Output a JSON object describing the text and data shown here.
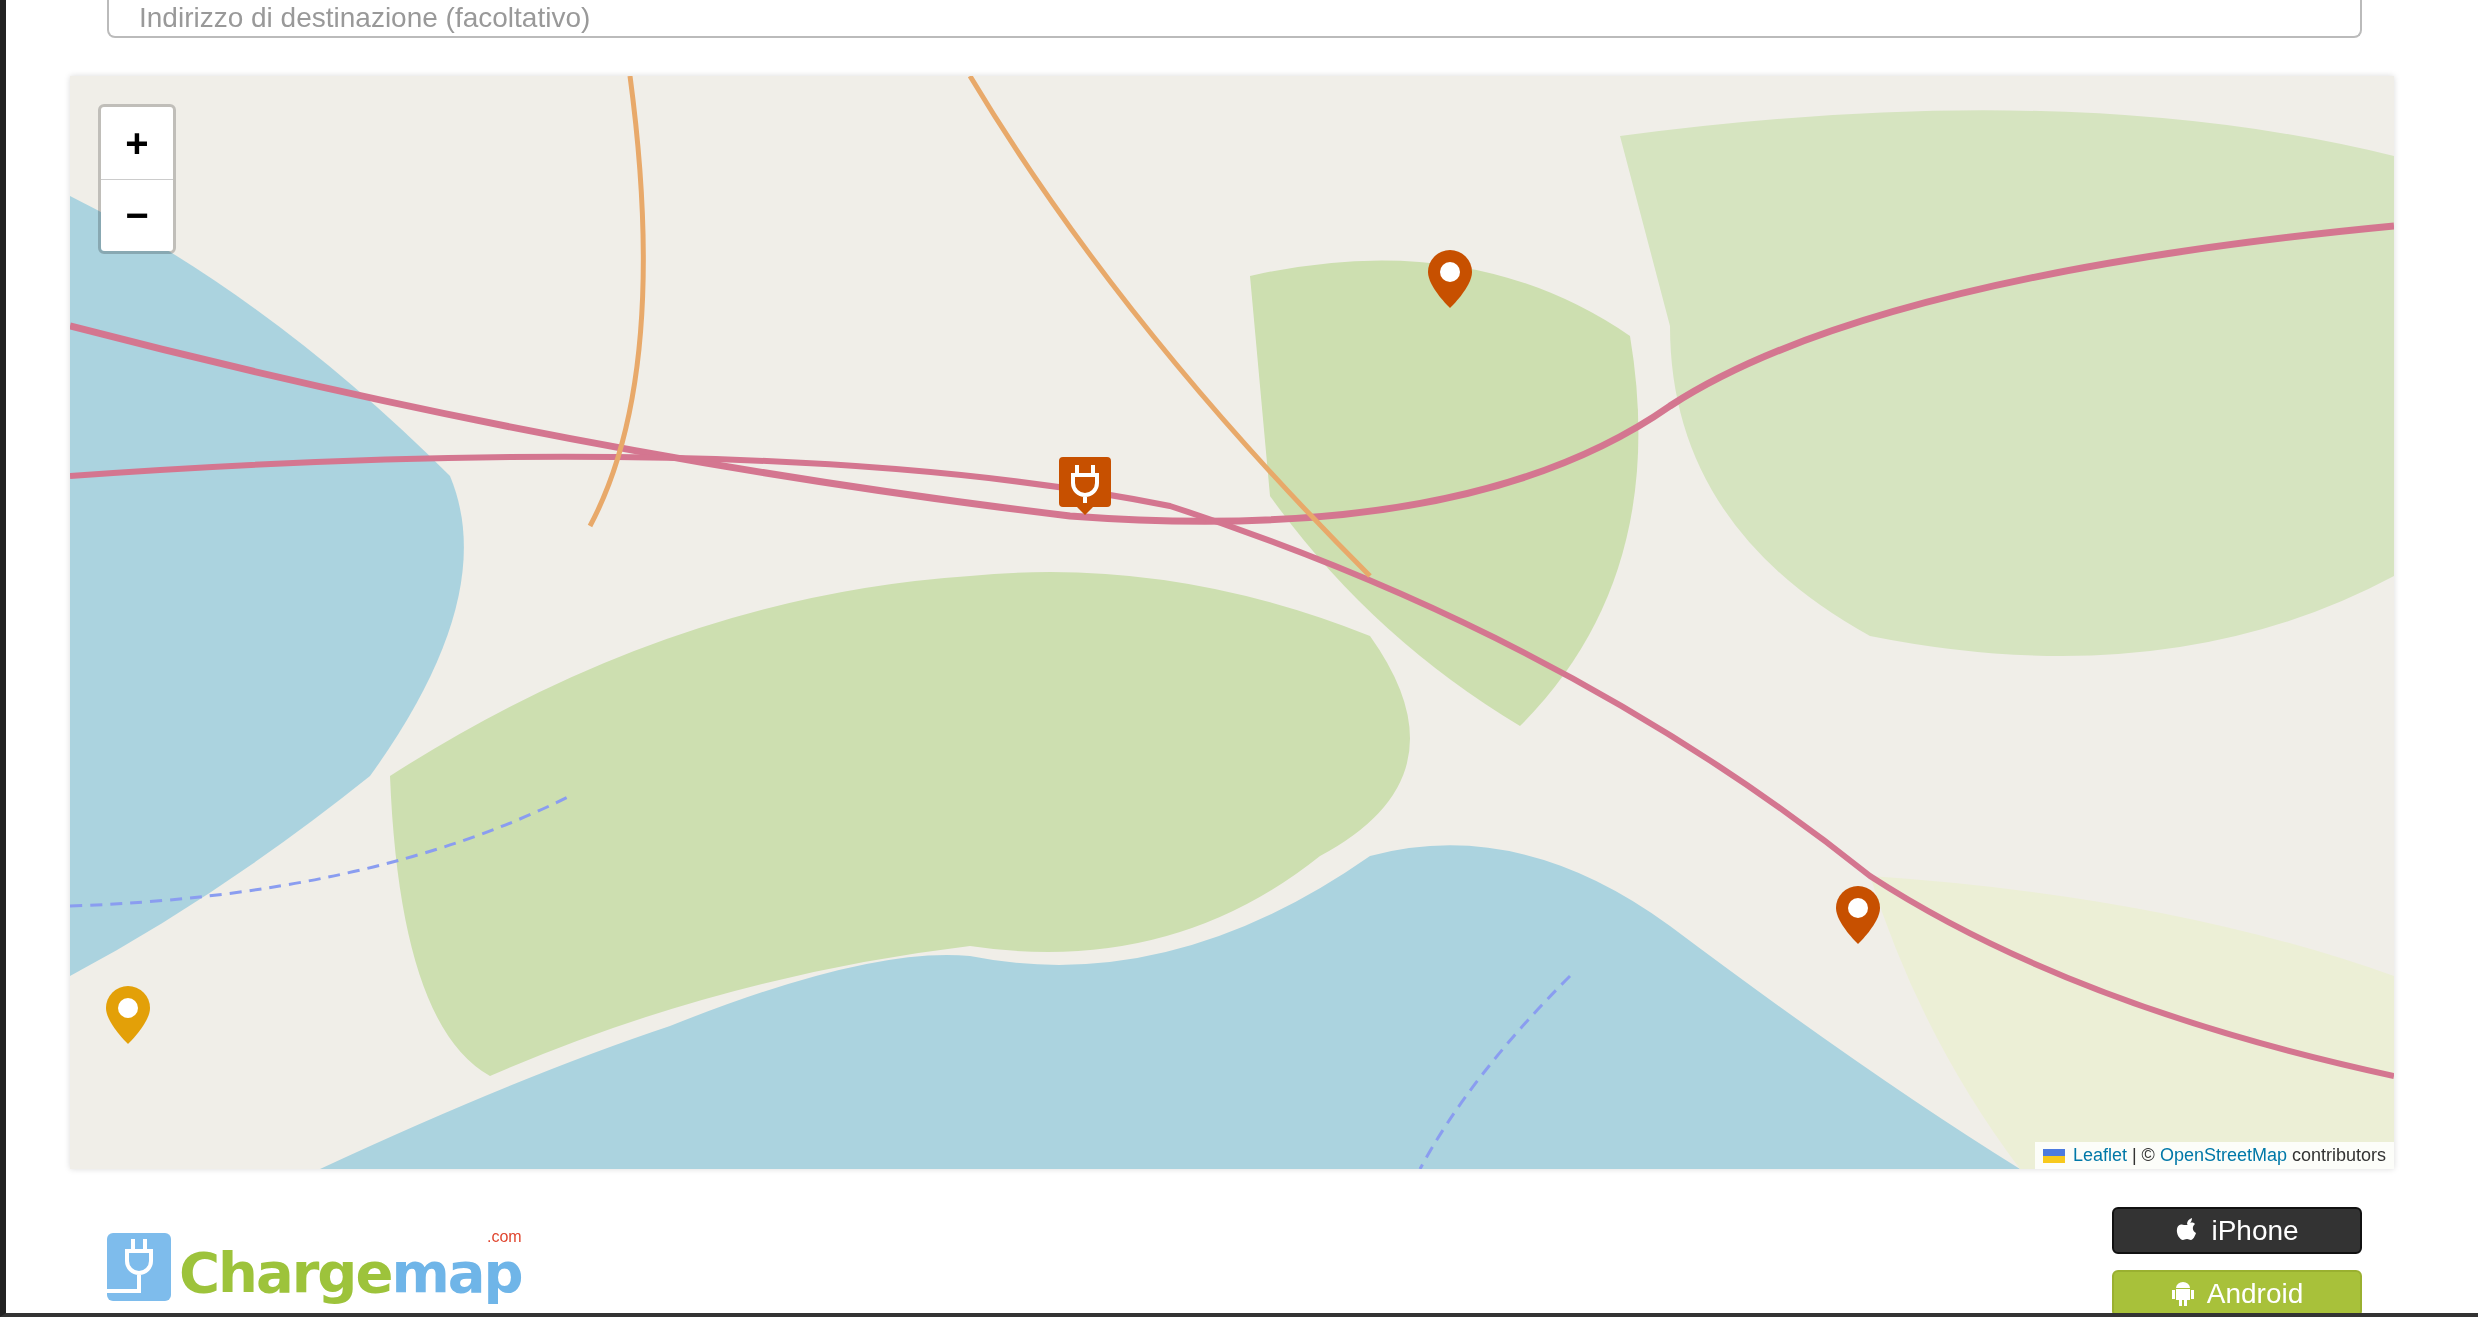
{
  "destination_field": {
    "placeholder": "Indirizzo di destinazione (facoltativo)"
  },
  "map": {
    "kind": "picture",
    "zoom_controls": [
      "+",
      "−"
    ],
    "markers": [
      {
        "kind": "pin",
        "color": "#c75000"
      },
      {
        "kind": "charger",
        "color": "#c75000"
      },
      {
        "kind": "pin",
        "color": "#c75000"
      },
      {
        "kind": "pin",
        "color": "#e3a008"
      }
    ],
    "attribution": {
      "links": [
        "Leaflet",
        "OpenStreetMap"
      ],
      "separator": "| ©",
      "suffix": "contributors"
    }
  },
  "logo": {
    "part_1": "Charge",
    "part_2": "map",
    "domain": ".com"
  },
  "app_buttons": [
    {
      "kind": "apple",
      "label": "iPhone"
    },
    {
      "kind": "android",
      "label": "Android"
    }
  ]
}
